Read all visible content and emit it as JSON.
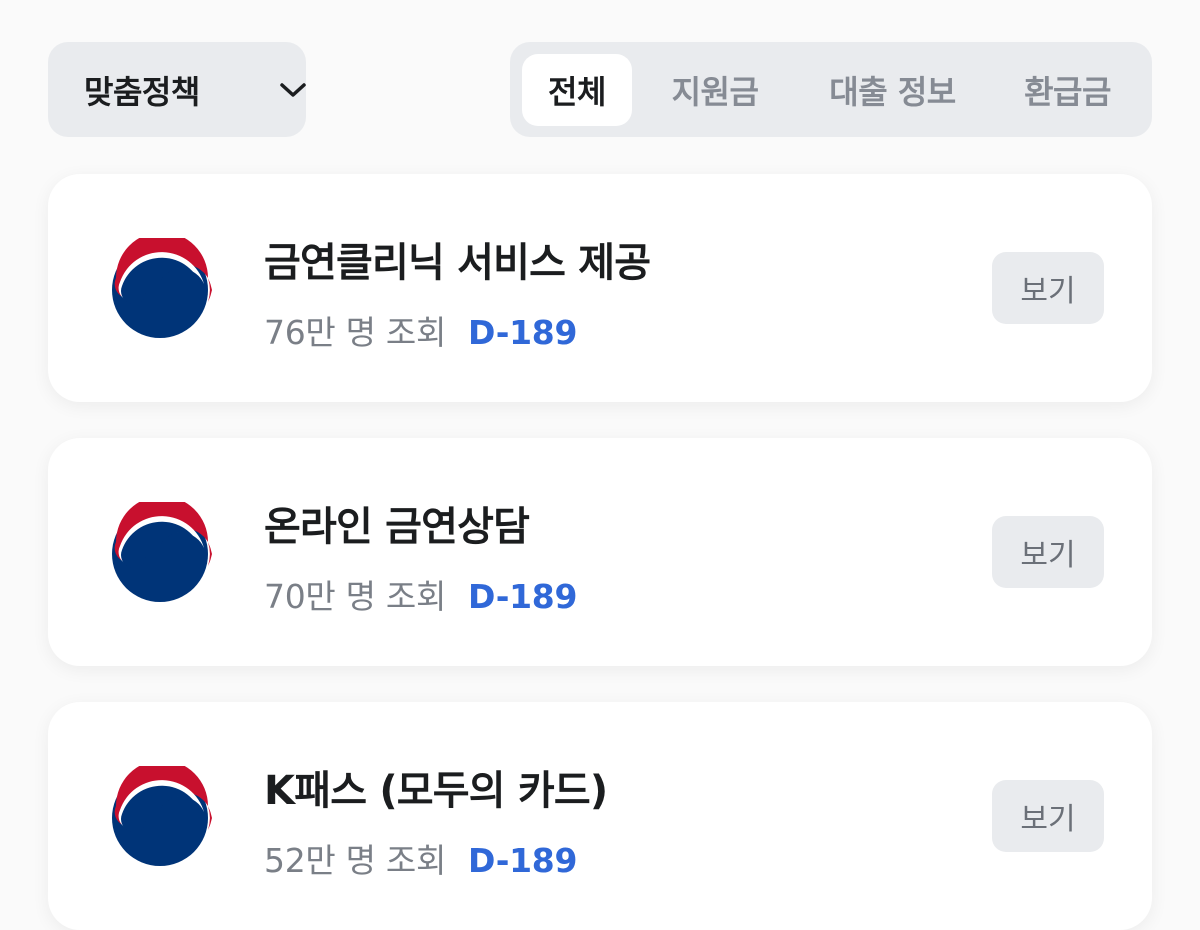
{
  "filter": {
    "label": "맞춤정책",
    "icon": "chevron-down-icon"
  },
  "tabs": [
    {
      "label": "전체",
      "active": true
    },
    {
      "label": "지원금",
      "active": false
    },
    {
      "label": "대출 정보",
      "active": false
    },
    {
      "label": "환급금",
      "active": false
    }
  ],
  "items": [
    {
      "title": "금연클리닉 서비스 제공",
      "views": "76만 명 조회",
      "dday": "D-189",
      "button": "보기",
      "icon": "korea-government-emblem-icon"
    },
    {
      "title": "온라인 금연상담",
      "views": "70만 명 조회",
      "dday": "D-189",
      "button": "보기",
      "icon": "korea-government-emblem-icon"
    },
    {
      "title": "K패스 (모두의 카드)",
      "views": "52만 명 조회",
      "dday": "D-189",
      "button": "보기",
      "icon": "korea-government-emblem-icon"
    }
  ],
  "colors": {
    "accent": "#3068d8",
    "emblem_red": "#c8102e",
    "emblem_blue": "#003478",
    "chip_bg": "#e9ebee"
  }
}
